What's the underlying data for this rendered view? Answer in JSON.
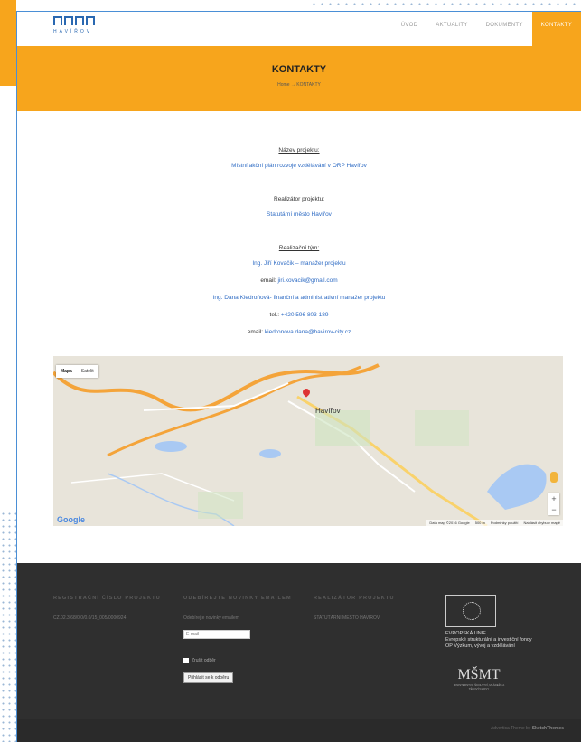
{
  "header": {
    "logo_text": "HAVÍŘOV",
    "nav": [
      {
        "label": "ÚVOD"
      },
      {
        "label": "AKTUALITY"
      },
      {
        "label": "DOKUMENTY"
      },
      {
        "label": "KONTAKTY"
      }
    ]
  },
  "title_band": {
    "title": "KONTAKTY",
    "breadcrumb": "Home → KONTAKTY"
  },
  "content": {
    "project_name_label": "Název projektu:",
    "project_name": "Místní akční plán rozvoje vzdělávání v ORP Havířov",
    "implementer_label": "Realizátor projektu:",
    "implementer": "Statutární město Havířov",
    "team_label": "Realizační tým:",
    "member1": "Ing. Jiří Kovačik – manažer projektu",
    "member1_email_prefix": "email:",
    "member1_email": "jiri.kovacik@gmail.com",
    "member2": "Ing. Dana Kiedroňová- finanční a administrativní manažer projektu",
    "tel_prefix": "tel.:",
    "tel": "+420 596 803 189",
    "member2_email_prefix": "email:",
    "member2_email": "kiedronova.dana@havirov-city.cz"
  },
  "map": {
    "type_map": "Mapa",
    "type_sat": "Satelit",
    "city": "Havířov",
    "google": "Google",
    "map_data": "Data map ©2016 Google",
    "scale": "500 m",
    "terms": "Podmínky použití",
    "report": "Nahlásit chybu v mapě",
    "zoom_in": "+",
    "zoom_out": "−"
  },
  "footer": {
    "col1_head": "REGISTRAČNÍ ČÍSLO PROJEKTU",
    "col1_text": "CZ.02.3.68/0.0/0.0/15_005/0000924",
    "col2_head": "ODEBÍREJTE NOVINKY EMAILEM",
    "col2_text": "Odebírejte novinky emailem",
    "email_placeholder": "E-mail",
    "unsubscribe": "Zrušit odběr",
    "subscribe_btn": "Přihlásit se k odběru",
    "col3_head": "REALIZÁTOR PROJEKTU",
    "col3_text": "STATUTÁRNÍ MĚSTO HAVÍŘOV",
    "eu_line1": "EVROPSKÁ UNIE",
    "eu_line2": "Evropské strukturální a investiční fondy",
    "eu_line3": "OP Výzkum, vývoj a vzdělávání",
    "msmt_mark": "MŠMT",
    "msmt_sub": "MINISTERSTVO ŠKOLSTVÍ, MLÁDEŽE A TĚLOVÝCHOVY",
    "theme_prefix": "Advertica Theme by",
    "theme_author": "SketchThemes"
  }
}
